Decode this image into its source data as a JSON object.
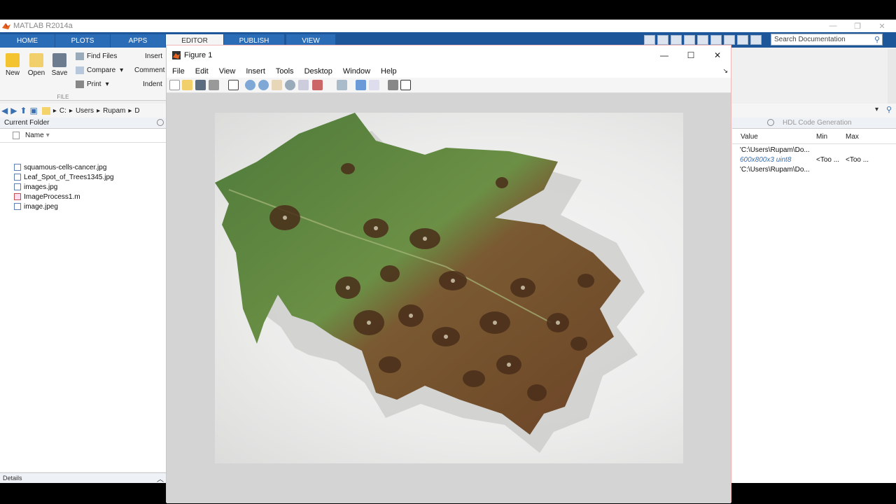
{
  "app": {
    "title": "MATLAB R2014a",
    "accent": "#1e5799"
  },
  "ribbon_tabs": [
    {
      "label": "HOME"
    },
    {
      "label": "PLOTS"
    },
    {
      "label": "APPS"
    },
    {
      "label": "EDITOR",
      "active": true
    },
    {
      "label": "PUBLISH"
    },
    {
      "label": "VIEW"
    }
  ],
  "search": {
    "placeholder": "Search Documentation"
  },
  "ribbon": {
    "new": "New",
    "open": "Open",
    "save": "Save",
    "find_files": "Find Files",
    "compare": "Compare",
    "print": "Print",
    "insert": "Insert",
    "comment": "Comment",
    "indent": "Indent",
    "file_section": "FILE"
  },
  "address": {
    "segments": [
      "C:",
      "Users",
      "Rupam",
      "D"
    ]
  },
  "current_folder": {
    "title": "Current Folder",
    "name_col": "Name",
    "files": [
      {
        "name": "squamous-cells-cancer.jpg",
        "type": "img"
      },
      {
        "name": "Leaf_Spot_of_Trees1345.jpg",
        "type": "img"
      },
      {
        "name": "images.jpg",
        "type": "img"
      },
      {
        "name": "ImageProcess1.m",
        "type": "m"
      },
      {
        "name": "image.jpeg",
        "type": "img"
      }
    ],
    "details": "Details"
  },
  "workspace": {
    "panel_title": "HDL Code Generation",
    "cols": {
      "value": "Value",
      "min": "Min",
      "max": "Max"
    },
    "rows": [
      {
        "value": "'C:\\Users\\Rupam\\Do...",
        "min": "",
        "max": ""
      },
      {
        "value": "600x800x3 uint8",
        "min": "<Too ...",
        "max": "<Too ..."
      },
      {
        "value": "'C:\\Users\\Rupam\\Do...",
        "min": "",
        "max": ""
      }
    ]
  },
  "figure": {
    "title": "Figure 1",
    "menu": [
      "File",
      "Edit",
      "View",
      "Insert",
      "Tools",
      "Desktop",
      "Window",
      "Help"
    ]
  }
}
